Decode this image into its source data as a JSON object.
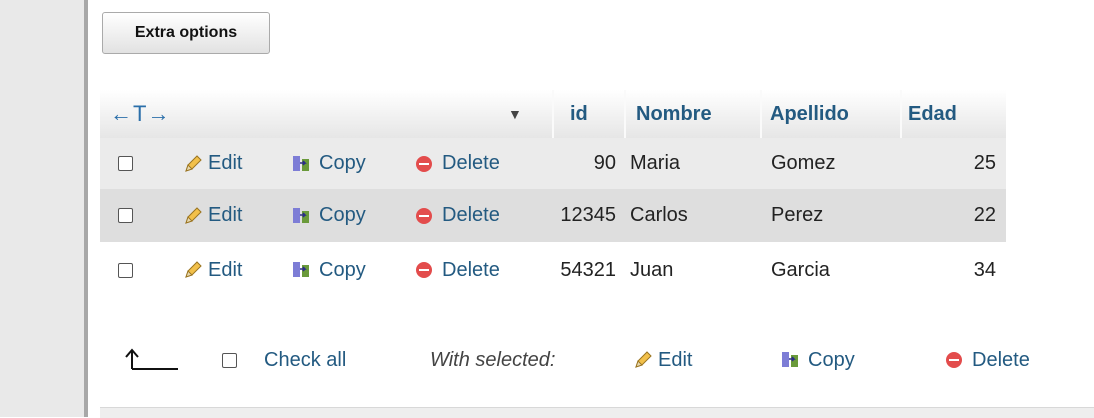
{
  "toolbar": {
    "extra_options_label": "Extra options"
  },
  "table": {
    "columns": {
      "id": "id",
      "nombre": "Nombre",
      "apellido": "Apellido",
      "edad": "Edad"
    },
    "arrows": "←T→",
    "sort_glyph": "▼",
    "actions": {
      "edit": "Edit",
      "copy": "Copy",
      "delete": "Delete"
    },
    "rows": [
      {
        "id": "90",
        "nombre": "Maria",
        "apellido": "Gomez",
        "edad": "25"
      },
      {
        "id": "12345",
        "nombre": "Carlos",
        "apellido": "Perez",
        "edad": "22"
      },
      {
        "id": "54321",
        "nombre": "Juan",
        "apellido": "Garcia",
        "edad": "34"
      }
    ]
  },
  "footer": {
    "check_all": "Check all",
    "with_selected": "With selected:",
    "edit": "Edit",
    "copy": "Copy",
    "delete": "Delete"
  },
  "colors": {
    "link": "#235a81",
    "delete_icon": "#e34c4c",
    "row_alt": "#dedede"
  },
  "icons": [
    "pencil-icon",
    "copy-icon",
    "delete-icon",
    "sort-icon",
    "check-all-arrow-icon"
  ]
}
